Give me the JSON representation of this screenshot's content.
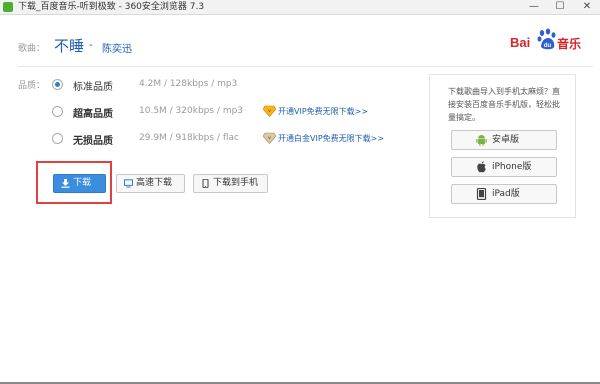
{
  "window": {
    "title": "下载_百度音乐-听到极致 - 360安全浏览器 7.3",
    "minimize": "—",
    "maximize": "☐",
    "close": "✕"
  },
  "song": {
    "label": "歌曲：",
    "title": "不睡",
    "separator": "-",
    "artist": "陈奕迅"
  },
  "logo": {
    "text_bai": "Bai",
    "paw_text": "du",
    "text_music": "音乐",
    "brand_color": "#d7252a"
  },
  "quality": {
    "label": "品质：",
    "options": [
      {
        "name": "标准品质",
        "info": "4.2M / 128kbps / mp3",
        "selected": true,
        "vip_link": ""
      },
      {
        "name": "超高品质",
        "info": "10.5M / 320kbps / mp3",
        "selected": false,
        "vip_link": "开通VIP免费无限下载>>"
      },
      {
        "name": "无损品质",
        "info": "29.9M / 918kbps / flac",
        "selected": false,
        "vip_link": "开通白金VIP免费无限下载>>"
      }
    ]
  },
  "actions": {
    "download": "下载",
    "fast_download": "高速下载",
    "download_to_phone": "下载到手机"
  },
  "side_panel": {
    "text": "下载歌曲导入到手机太麻烦？直接安装百度音乐手机版，轻松批量搞定。",
    "android": "安卓版",
    "iphone": "iPhone版",
    "ipad": "iPad版"
  },
  "colors": {
    "accent": "#3b8de0",
    "link": "#1f5fae",
    "highlight": "#e0403f"
  }
}
